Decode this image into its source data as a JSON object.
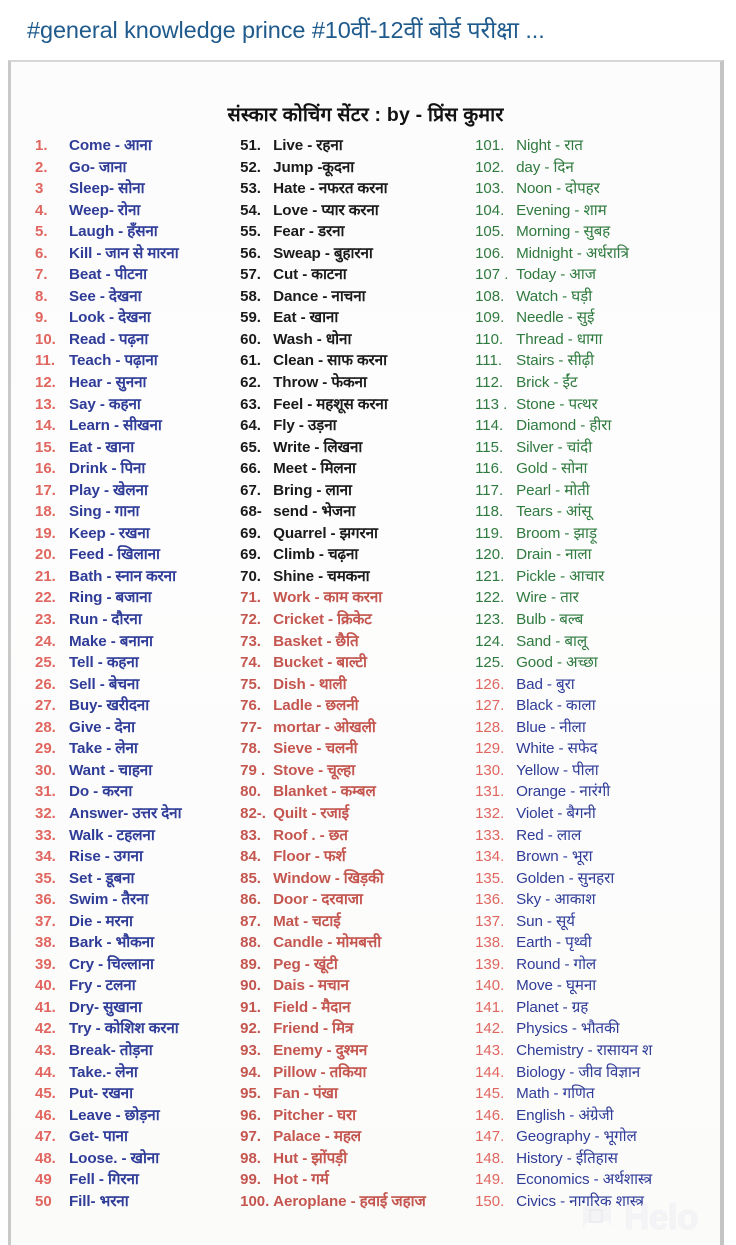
{
  "header": {
    "title": "#general knowledge prince  #10वीं-12वीं बोर्ड परीक्षा ..."
  },
  "sheet": {
    "title": "संस्कार कोचिंग सेंटर : by - प्रिंस कुमार"
  },
  "watermark": {
    "label": "Helo",
    "icon": "helo-logo-icon"
  },
  "colors": {
    "header_blue": "#1f5a8c",
    "col1_number_red": "#e0665f",
    "col1_text_blue": "#2f3c98",
    "col2_black": "#1a1a1a",
    "col2_red": "#c4564f",
    "col3_green": "#2f7a3e",
    "col3_blue": "#2f3c98",
    "card_background": "#fbfbfb"
  },
  "columns": [
    {
      "name": "column-one",
      "rows": [
        {
          "num": "1.",
          "text": "Come - आना",
          "theme": "t-blue"
        },
        {
          "num": "2.",
          "text": "Go- जाना",
          "theme": "t-blue"
        },
        {
          "num": "3",
          "text": "Sleep- सोना",
          "theme": "t-blue"
        },
        {
          "num": "4.",
          "text": "Weep- रोना",
          "theme": "t-blue"
        },
        {
          "num": "5.",
          "text": "Laugh - हँसना",
          "theme": "t-blue"
        },
        {
          "num": "6.",
          "text": "Kill - जान से मारना",
          "theme": "t-blue"
        },
        {
          "num": "7.",
          "text": "Beat - पीटना",
          "theme": "t-blue"
        },
        {
          "num": "8.",
          "text": "See - देखना",
          "theme": "t-blue"
        },
        {
          "num": "9.",
          "text": "Look - देखना",
          "theme": "t-blue"
        },
        {
          "num": "10.",
          "text": "Read - पढ़ना",
          "theme": "t-blue"
        },
        {
          "num": "11.",
          "text": "Teach - पढ़ाना",
          "theme": "t-blue"
        },
        {
          "num": "12.",
          "text": "Hear - सुनना",
          "theme": "t-blue"
        },
        {
          "num": "13.",
          "text": "Say - कहना",
          "theme": "t-blue"
        },
        {
          "num": "14.",
          "text": "Learn - सीखना",
          "theme": "t-blue"
        },
        {
          "num": "15.",
          "text": "Eat - खाना",
          "theme": "t-blue"
        },
        {
          "num": "16.",
          "text": "Drink - पिना",
          "theme": "t-blue"
        },
        {
          "num": "17.",
          "text": "Play - खेलना",
          "theme": "t-blue"
        },
        {
          "num": "18.",
          "text": "Sing - गाना",
          "theme": "t-blue"
        },
        {
          "num": "19.",
          "text": "Keep - रखना",
          "theme": "t-blue"
        },
        {
          "num": "20.",
          "text": "Feed - खिलाना",
          "theme": "t-blue"
        },
        {
          "num": "21.",
          "text": "Bath - स्नान करना",
          "theme": "t-blue"
        },
        {
          "num": "22.",
          "text": "Ring - बजाना",
          "theme": "t-blue"
        },
        {
          "num": "23.",
          "text": "Run - दौरना",
          "theme": "t-blue"
        },
        {
          "num": "24.",
          "text": "Make - बनाना",
          "theme": "t-blue"
        },
        {
          "num": "25.",
          "text": "Tell - कहना",
          "theme": "t-blue"
        },
        {
          "num": "26.",
          "text": "Sell - बेचना",
          "theme": "t-blue"
        },
        {
          "num": "27.",
          "text": "Buy- खरीदना",
          "theme": "t-blue"
        },
        {
          "num": "28.",
          "text": "Give - देना",
          "theme": "t-blue"
        },
        {
          "num": "29.",
          "text": "Take - लेना",
          "theme": "t-blue"
        },
        {
          "num": "30.",
          "text": "Want - चाहना",
          "theme": "t-blue"
        },
        {
          "num": "31.",
          "text": "Do - करना",
          "theme": "t-blue"
        },
        {
          "num": "32.",
          "text": "Answer- उत्तर देना",
          "theme": "t-blue"
        },
        {
          "num": "33.",
          "text": "Walk - टहलना",
          "theme": "t-blue"
        },
        {
          "num": "34.",
          "text": "Rise - उगना",
          "theme": "t-blue"
        },
        {
          "num": "35.",
          "text": "Set - डूबना",
          "theme": "t-blue"
        },
        {
          "num": "36.",
          "text": "Swim - तैरना",
          "theme": "t-blue"
        },
        {
          "num": "37.",
          "text": "Die - मरना",
          "theme": "t-blue"
        },
        {
          "num": "38.",
          "text": "Bark - भौकना",
          "theme": "t-blue"
        },
        {
          "num": "39.",
          "text": "Cry - चिल्लाना",
          "theme": "t-blue"
        },
        {
          "num": "40.",
          "text": "Fry - टलना",
          "theme": "t-blue"
        },
        {
          "num": "41.",
          "text": "Dry- सुखाना",
          "theme": "t-blue"
        },
        {
          "num": "42.",
          "text": "Try - कोशिश करना",
          "theme": "t-blue"
        },
        {
          "num": "43.",
          "text": "Break- तोड़ना",
          "theme": "t-blue"
        },
        {
          "num": "44.",
          "text": "Take.- लेना",
          "theme": "t-blue"
        },
        {
          "num": "45.",
          "text": "Put- रखना",
          "theme": "t-blue"
        },
        {
          "num": "46.",
          "text": "Leave - छोड़ना",
          "theme": "t-blue"
        },
        {
          "num": "47.",
          "text": "Get- पाना",
          "theme": "t-blue"
        },
        {
          "num": "48.",
          "text": "Loose. - खोना",
          "theme": "t-blue"
        },
        {
          "num": "49",
          "text": "Fell - गिरना",
          "theme": "t-blue"
        },
        {
          "num": "50",
          "text": "Fill- भरना",
          "theme": "t-blue"
        }
      ]
    },
    {
      "name": "column-two",
      "rows": [
        {
          "num": "51.",
          "text": "Live - रहना",
          "theme": "t-black"
        },
        {
          "num": "52.",
          "text": "Jump -कूदना",
          "theme": "t-black"
        },
        {
          "num": "53.",
          "text": "Hate - नफरत करना",
          "theme": "t-black"
        },
        {
          "num": "54.",
          "text": "Love - प्यार करना",
          "theme": "t-black"
        },
        {
          "num": "55.",
          "text": "Fear -  डरना",
          "theme": "t-black"
        },
        {
          "num": "56.",
          "text": "Sweap - बुहारना",
          "theme": "t-black"
        },
        {
          "num": "57.",
          "text": "Cut - काटना",
          "theme": "t-black"
        },
        {
          "num": "58.",
          "text": "Dance - नाचना",
          "theme": "t-black"
        },
        {
          "num": "59.",
          "text": "Eat - खाना",
          "theme": "t-black"
        },
        {
          "num": "60.",
          "text": "Wash - धोना",
          "theme": "t-black"
        },
        {
          "num": "61.",
          "text": " Clean - साफ करना",
          "theme": "t-black"
        },
        {
          "num": "62.",
          "text": "Throw - फेकना",
          "theme": "t-black"
        },
        {
          "num": "63.",
          "text": "Feel - महशूस करना",
          "theme": "t-black"
        },
        {
          "num": "64.",
          "text": "Fly - उड़ना",
          "theme": "t-black"
        },
        {
          "num": "65.",
          "text": "Write - लिखना",
          "theme": "t-black"
        },
        {
          "num": "66.",
          "text": "Meet - मिलना",
          "theme": "t-black"
        },
        {
          "num": "67.",
          "text": "Bring - लाना",
          "theme": "t-black"
        },
        {
          "num": "68-",
          "text": "send - भेजना",
          "theme": "t-black"
        },
        {
          "num": "69.",
          "text": "Quarrel - झगरना",
          "theme": "t-black"
        },
        {
          "num": "69.",
          "text": "Climb - चढ़ना",
          "theme": "t-black"
        },
        {
          "num": "70.",
          "text": "Shine - चमकना",
          "theme": "t-black"
        },
        {
          "num": "71.",
          "text": "Work - काम करना",
          "theme": "t-red"
        },
        {
          "num": "72.",
          "text": "Cricket - क्रिकेट",
          "theme": "t-red"
        },
        {
          "num": "73.",
          "text": "Basket - छैति",
          "theme": "t-red"
        },
        {
          "num": "74.",
          "text": "Bucket - बाल्टी",
          "theme": "t-red"
        },
        {
          "num": "75.",
          "text": "Dish - थाली",
          "theme": "t-red"
        },
        {
          "num": "76.",
          "text": "Ladle - छलनी",
          "theme": "t-red"
        },
        {
          "num": "77-",
          "text": "mortar - ओखली",
          "theme": "t-red"
        },
        {
          "num": "78.",
          "text": "Sieve - चलनी",
          "theme": "t-red"
        },
        {
          "num": "79 .",
          "text": "Stove - चूल्हा",
          "theme": "t-red"
        },
        {
          "num": "80.",
          "text": "Blanket - कम्बल",
          "theme": "t-red"
        },
        {
          "num": "82-.",
          "text": "Quilt - रजाई",
          "theme": "t-red"
        },
        {
          "num": "83.",
          "text": "Roof . - छत",
          "theme": "t-red"
        },
        {
          "num": "84.",
          "text": "Floor - फर्श",
          "theme": "t-red"
        },
        {
          "num": "85.",
          "text": "Window - खिड़की",
          "theme": "t-red"
        },
        {
          "num": "86.",
          "text": "Door - दरवाजा",
          "theme": "t-red"
        },
        {
          "num": "87.",
          "text": "Mat - चटाई",
          "theme": "t-red"
        },
        {
          "num": "88.",
          "text": "Candle - मोमबत्ती",
          "theme": "t-red"
        },
        {
          "num": "89.",
          "text": "Peg - खूंटी",
          "theme": "t-red"
        },
        {
          "num": "90.",
          "text": "Dais - मचान",
          "theme": "t-red"
        },
        {
          "num": "91.",
          "text": "Field - मैदान",
          "theme": "t-red"
        },
        {
          "num": "92.",
          "text": "Friend - मित्र",
          "theme": "t-red"
        },
        {
          "num": "93.",
          "text": "Enemy - दुश्मन",
          "theme": "t-red"
        },
        {
          "num": "94.",
          "text": "Pillow - तकिया",
          "theme": "t-red"
        },
        {
          "num": "95.",
          "text": "Fan - पंखा",
          "theme": "t-red"
        },
        {
          "num": "96.",
          "text": "Pitcher - घरा",
          "theme": "t-red"
        },
        {
          "num": "97.",
          "text": "Palace - महल",
          "theme": "t-red"
        },
        {
          "num": "98.",
          "text": "Hut - झोंपड़ी",
          "theme": "t-red"
        },
        {
          "num": "99.",
          "text": "Hot - गर्म",
          "theme": "t-red"
        },
        {
          "num": "100.",
          "text": "Aeroplane - हवाई जहाज",
          "theme": "t-red"
        }
      ]
    },
    {
      "name": "column-three",
      "rows": [
        {
          "num": "101.",
          "text": "Night - रात",
          "theme": "t-green"
        },
        {
          "num": "102.",
          "text": "day - दिन",
          "theme": "t-green"
        },
        {
          "num": "103.",
          "text": "Noon - दोपहर",
          "theme": "t-green"
        },
        {
          "num": "104.",
          "text": "Evening - शाम",
          "theme": "t-green"
        },
        {
          "num": "105.",
          "text": "Morning - सुबह",
          "theme": "t-green"
        },
        {
          "num": "106.",
          "text": "Midnight - अर्धरात्रि",
          "theme": "t-green"
        },
        {
          "num": "107 .",
          "text": "Today - आज",
          "theme": "t-green"
        },
        {
          "num": "108.",
          "text": "Watch - घड़ी",
          "theme": "t-green"
        },
        {
          "num": "109.",
          "text": "Needle - सुई",
          "theme": "t-green"
        },
        {
          "num": "110.",
          "text": "Thread - धागा",
          "theme": "t-green"
        },
        {
          "num": "111.",
          "text": "Stairs - सीढ़ी",
          "theme": "t-green"
        },
        {
          "num": "112.",
          "text": "Brick - ईंट",
          "theme": "t-green"
        },
        {
          "num": "113 .",
          "text": "Stone - पत्थर",
          "theme": "t-green"
        },
        {
          "num": "114.",
          "text": "Diamond - हीरा",
          "theme": "t-green"
        },
        {
          "num": "115.",
          "text": "Silver - चांदी",
          "theme": "t-green"
        },
        {
          "num": "116.",
          "text": "Gold - सोना",
          "theme": "t-green"
        },
        {
          "num": "117.",
          "text": "Pearl - मोती",
          "theme": "t-green"
        },
        {
          "num": "118.",
          "text": "Tears - आंसू",
          "theme": "t-green"
        },
        {
          "num": "119.",
          "text": "Broom - झाड़ू",
          "theme": "t-green"
        },
        {
          "num": "120.",
          "text": "Drain - नाला",
          "theme": "t-green"
        },
        {
          "num": "121.",
          "text": "Pickle - आचार",
          "theme": "t-green"
        },
        {
          "num": "122.",
          "text": "Wire - तार",
          "theme": "t-green"
        },
        {
          "num": "123.",
          "text": "Bulb - बल्ब",
          "theme": "t-green"
        },
        {
          "num": "124.",
          "text": "Sand - बालू",
          "theme": "t-green"
        },
        {
          "num": "125.",
          "text": "Good - अच्छा",
          "theme": "t-green"
        },
        {
          "num": "126.",
          "text": "Bad - बुरा",
          "theme": "t-blue"
        },
        {
          "num": "127.",
          "text": "Black - काला",
          "theme": "t-blue"
        },
        {
          "num": "128.",
          "text": "Blue - नीला",
          "theme": "t-blue"
        },
        {
          "num": "129.",
          "text": "White - सफेद",
          "theme": "t-blue"
        },
        {
          "num": "130.",
          "text": "Yellow - पीला",
          "theme": "t-blue"
        },
        {
          "num": "131.",
          "text": "Orange - नारंगी",
          "theme": "t-blue"
        },
        {
          "num": "132.",
          "text": "Violet - बैगनी",
          "theme": "t-blue"
        },
        {
          "num": "133.",
          "text": "Red - लाल",
          "theme": "t-blue"
        },
        {
          "num": "134.",
          "text": "Brown - भूरा",
          "theme": "t-blue"
        },
        {
          "num": "135.",
          "text": "Golden - सुनहरा",
          "theme": "t-blue"
        },
        {
          "num": "136.",
          "text": "Sky - आकाश",
          "theme": "t-blue"
        },
        {
          "num": "137.",
          "text": "Sun - सूर्य",
          "theme": "t-blue"
        },
        {
          "num": "138.",
          "text": "Earth - पृथ्वी",
          "theme": "t-blue"
        },
        {
          "num": "139.",
          "text": "Round - गोल",
          "theme": "t-blue"
        },
        {
          "num": "140.",
          "text": "Move - घूमना",
          "theme": "t-blue"
        },
        {
          "num": "141.",
          "text": "Planet - ग्रह",
          "theme": "t-blue"
        },
        {
          "num": "142.",
          "text": "Physics - भौतकी",
          "theme": "t-blue"
        },
        {
          "num": "143.",
          "text": "Chemistry - रासायन श",
          "theme": "t-blue"
        },
        {
          "num": "144.",
          "text": "Biology - जीव विज्ञान",
          "theme": "t-blue"
        },
        {
          "num": "145.",
          "text": "Math - गणित",
          "theme": "t-blue"
        },
        {
          "num": "146.",
          "text": "English - अंग्रेजी",
          "theme": "t-blue"
        },
        {
          "num": "147.",
          "text": "Geography - भूगोल",
          "theme": "t-blue"
        },
        {
          "num": "148.",
          "text": "History - ईतिहास",
          "theme": "t-blue"
        },
        {
          "num": "149.",
          "text": "Economics - अर्थशास्त्र",
          "theme": "t-blue"
        },
        {
          "num": "150.",
          "text": "Civics - नागरिक शास्त्र",
          "theme": "t-blue"
        }
      ]
    }
  ]
}
